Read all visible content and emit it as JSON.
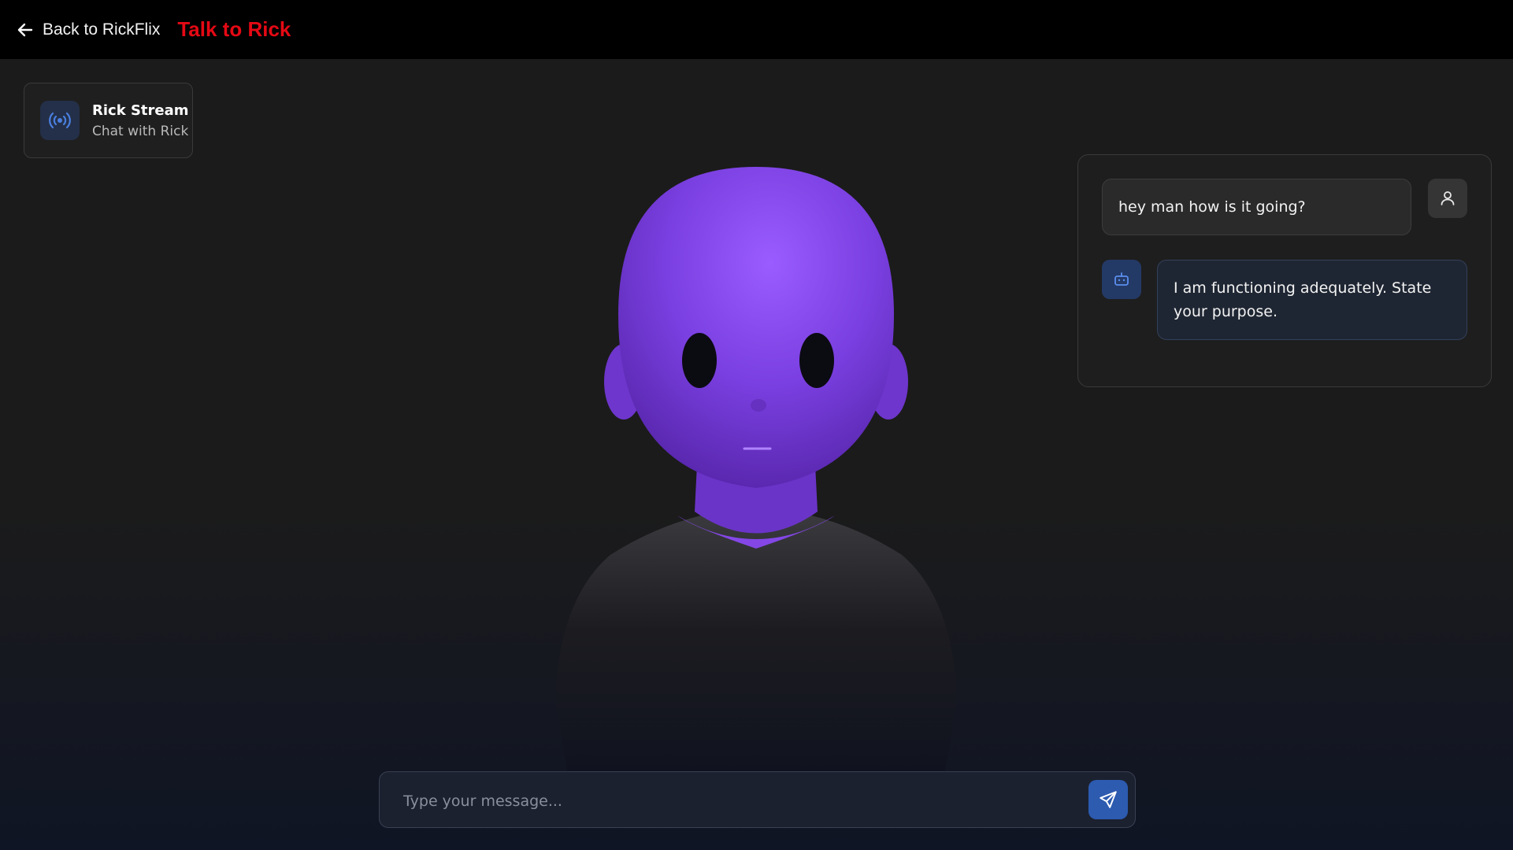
{
  "header": {
    "back_label": "Back to RickFlix",
    "title": "Talk to Rick",
    "title_color": "#e50914"
  },
  "stream_card": {
    "title": "Rick Stream",
    "subtitle": "Chat with Rick",
    "icon": "broadcast-icon"
  },
  "chat": {
    "messages": [
      {
        "role": "user",
        "text": "hey man how is it going?",
        "icon": "user-icon"
      },
      {
        "role": "bot",
        "text": "I am functioning adequately. State your purpose.",
        "icon": "bot-icon"
      }
    ]
  },
  "composer": {
    "placeholder": "Type your message...",
    "send_icon": "send-icon"
  },
  "colors": {
    "accent": "#2c5bb0",
    "avatar_skin": "#7a3fe0"
  }
}
